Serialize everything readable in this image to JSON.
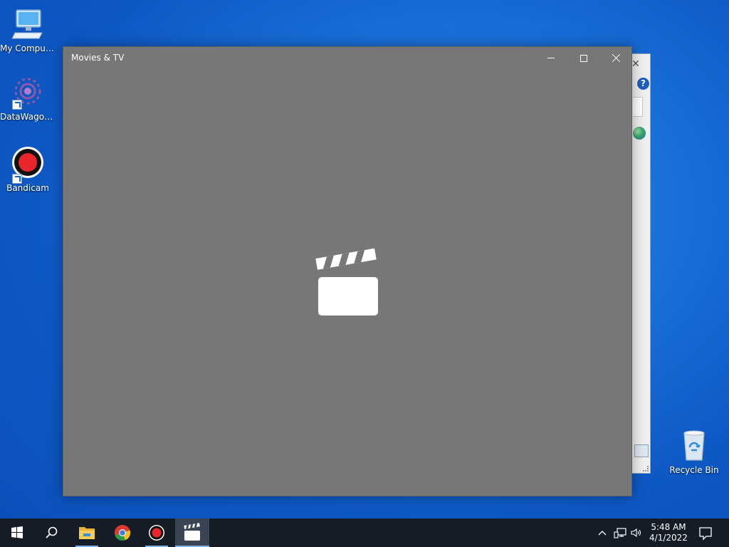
{
  "desktop": {
    "icons": [
      {
        "label": "My Computer",
        "icon": "computer-icon"
      },
      {
        "label": "DataWagon...",
        "icon": "gear-shortcut-icon"
      },
      {
        "label": "Bandicam",
        "icon": "record-icon"
      },
      {
        "label": "Recycle Bin",
        "icon": "recycle-bin-icon"
      }
    ]
  },
  "window": {
    "title": "Movies & TV",
    "buttons": {
      "minimize": "minimize-icon",
      "maximize": "maximize-icon",
      "close": "close-icon"
    },
    "splash_icon": "clapperboard-icon",
    "background_color": "#777777"
  },
  "background_window": {
    "help_label": "?",
    "close_label": "✕"
  },
  "taskbar": {
    "items": [
      {
        "name": "start",
        "icon": "windows-logo-icon"
      },
      {
        "name": "search",
        "icon": "search-icon"
      },
      {
        "name": "file-explorer",
        "icon": "folder-icon",
        "running": true
      },
      {
        "name": "chrome",
        "icon": "chrome-icon"
      },
      {
        "name": "bandicam",
        "icon": "record-icon",
        "running": true
      },
      {
        "name": "movies-tv",
        "icon": "clapperboard-icon",
        "running": true,
        "active": true
      }
    ],
    "clock": {
      "time": "5:48 AM",
      "date": "4/1/2022"
    }
  },
  "colors": {
    "accent": "#7fb3e8",
    "taskbar": "#151c26",
    "desktop": "#1a6fd8"
  }
}
